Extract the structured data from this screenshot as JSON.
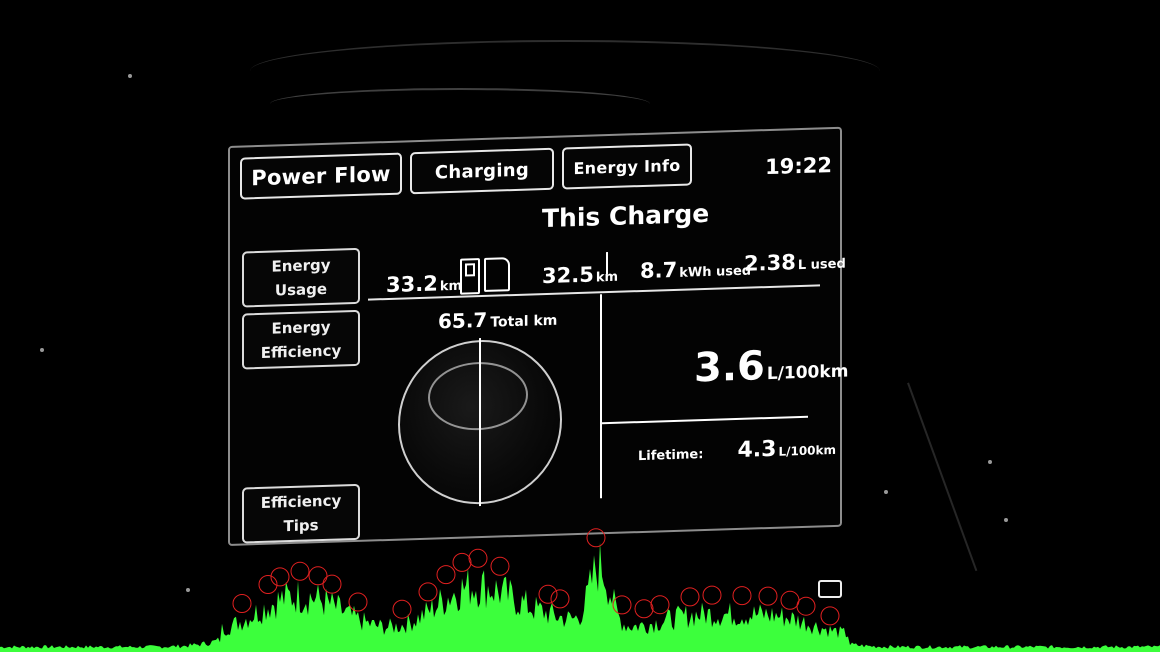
{
  "header": {
    "tabs": [
      {
        "label": "Power Flow"
      },
      {
        "label": "Charging"
      },
      {
        "label": "Energy Info"
      }
    ],
    "clock": "19:22"
  },
  "title": "This Charge",
  "sidebar": {
    "items": [
      {
        "line1": "Energy",
        "line2": "Usage"
      },
      {
        "line1": "Energy",
        "line2": "Efficiency"
      },
      {
        "line1": "Efficiency",
        "line2": "Tips"
      }
    ]
  },
  "stats": {
    "electric_distance": {
      "value": "33.2",
      "unit": "km"
    },
    "fuel_distance": {
      "value": "32.5",
      "unit": "km"
    },
    "energy_used": {
      "value": "8.7",
      "unit": "kWh used"
    },
    "fuel_used": {
      "value": "2.38",
      "unit": "L used"
    },
    "total": {
      "value": "65.7",
      "unit": "Total km"
    }
  },
  "consumption": {
    "value": "3.6",
    "unit": "L/100km"
  },
  "lifetime": {
    "label": "Lifetime:",
    "value": "4.3",
    "unit": "L/100km"
  },
  "icons": {
    "ev": "battery-icon",
    "fuel": "fuel-pump-icon",
    "bottom_right": "battery-indicator-icon"
  },
  "colors": {
    "histogram": "#3cff3c",
    "markers": "#e02020"
  }
}
